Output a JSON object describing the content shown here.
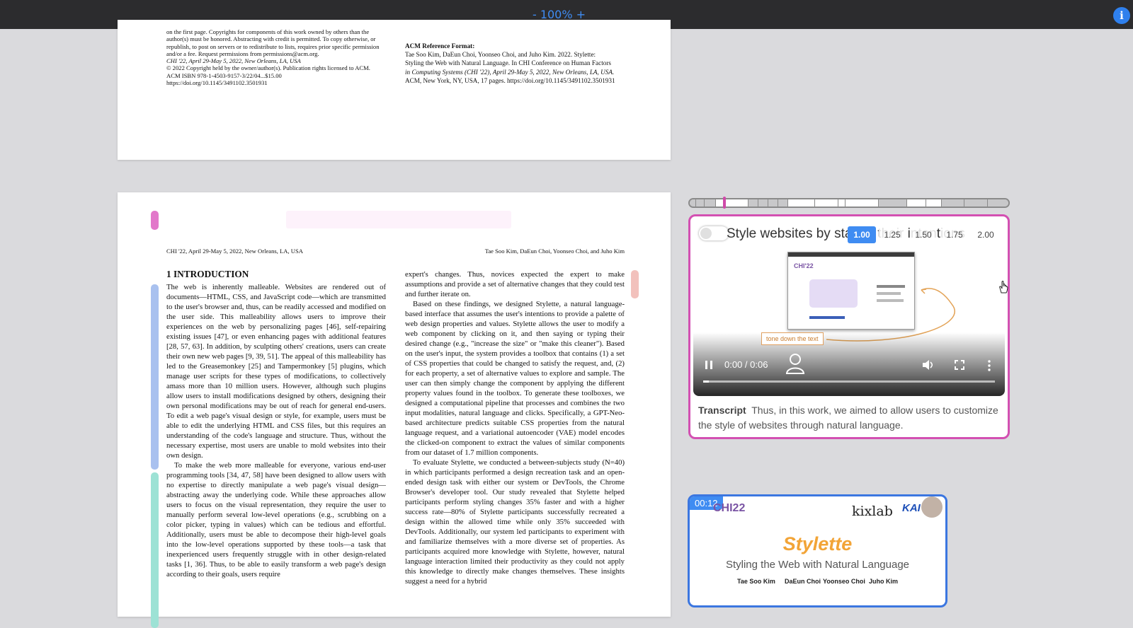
{
  "toolbar": {
    "zoom_out": "-",
    "zoom_level": "100%",
    "zoom_in": "+",
    "info_label": "i"
  },
  "page1": {
    "left_lines": [
      "on the first page. Copyrights for components of this work owned by others than the",
      "author(s) must be honored. Abstracting with credit is permitted. To copy otherwise, or",
      "republish, to post on servers or to redistribute to lists, requires prior specific permission",
      "and/or a fee. Request permissions from permissions@acm.org.",
      "CHI '22, April 29-May 5, 2022, New Orleans, LA, USA",
      "© 2022 Copyright held by the owner/author(s). Publication rights licensed to ACM.",
      "ACM ISBN 978-1-4503-9157-3/22/04...$15.00",
      "https://doi.org/10.1145/3491102.3501931"
    ],
    "ref_heading": "ACM Reference Format:",
    "ref_lines": [
      "Tae Soo Kim, DaEun Choi, Yoonseo Choi, and Juho Kim. 2022. Stylette:",
      "Styling the Web with Natural Language. In CHI Conference on Human Factors",
      "in Computing Systems (CHI '22), April 29-May 5, 2022, New Orleans, LA, USA.",
      "ACM, New York, NY, USA, 17 pages. https://doi.org/10.1145/3491102.3501931"
    ]
  },
  "page2": {
    "header_left": "CHI '22, April 29-May 5, 2022, New Orleans, LA, USA",
    "header_right": "Tae Soo Kim, DaEun Choi, Yoonseo Choi, and Juho Kim",
    "section_title": "1   INTRODUCTION",
    "left_p1": "The web is inherently malleable. Websites are rendered out of documents—HTML, CSS, and JavaScript code—which are transmitted to the user's browser and, thus, can be readily accessed and modified on the user side. This malleability allows users to improve their experiences on the web by personalizing pages [46], self-repairing existing issues [47], or even enhancing pages with additional features [28, 57, 63]. In addition, by sculpting others' creations, users can create their own new web pages [9, 39, 51]. The appeal of this malleability has led to the Greasemonkey [25] and Tampermonkey [5] plugins, which manage user scripts for these types of modifications, to collectively amass more than 10 million users. However, although such plugins allow users to install modifications designed by others, designing their own personal modifications may be out of reach for general end-users. To edit a web page's visual design or style, for example, users must be able to edit the underlying HTML and CSS files, but this requires an understanding of the code's language and structure. Thus, without the necessary expertise, most users are unable to mold websites into their own design.",
    "left_p2": "To make the web more malleable for everyone, various end-user programming tools [34, 47, 58] have been designed to allow users with no expertise to directly manipulate a web page's visual design—abstracting away the underlying code. While these approaches allow users to focus on the visual representation, they require the user to manually perform several low-level operations (e.g., scrubbing on a color picker, typing in values) which can be tedious and effortful. Additionally, users must be able to decompose their high-level goals into the low-level operations supported by these tools—a task that inexperienced users frequently struggle with in other design-related tasks [1, 36]. Thus, to be able to easily transform a web page's design according to their goals, users require",
    "right_p1": "expert's changes. Thus, novices expected the expert to make assumptions and provide a set of alternative changes that they could test and further iterate on.",
    "right_p2": "Based on these findings, we designed Stylette, a natural language-based interface that assumes the user's intentions to provide a palette of web design properties and values. Stylette allows the user to modify a web component by clicking on it, and then saying or typing their desired change (e.g., \"increase the size\" or \"make this cleaner\"). Based on the user's input, the system provides a toolbox that contains (1) a set of CSS properties that could be changed to satisfy the request, and, (2) for each property, a set of alternative values to explore and sample. The user can then simply change the component by applying the different property values found in the toolbox. To generate these toolboxes, we designed a computational pipeline that processes and combines the two input modalities, natural language and clicks. Specifically, a GPT-Neo-based architecture predicts suitable CSS properties from the natural language request, and a variational autoencoder (VAE) model encodes the clicked-on component to extract the values of similar components from our dataset of 1.7 million components.",
    "right_p3": "To evaluate Stylette, we conducted a between-subjects study (N=40) in which participants performed a design recreation task and an open-ended design task with either our system or DevTools, the Chrome Browser's developer tool. Our study revealed that Stylette helped participants perform styling changes 35% faster and with a higher success rate—80% of Stylette participants successfully recreated a design within the allowed time while only 35% succeeded with DevTools. Additionally, our system led participants to experiment with and familiarize themselves with a more diverse set of properties. As participants acquired more knowledge with Stylette, however, natural language interaction limited their productivity as they could not apply this knowledge to directly make changes themselves. These insights suggest a need for a hybrid"
  },
  "video_card": {
    "title": "Style websites by stating their intentions",
    "speeds": [
      "1.00",
      "1.25",
      "1.50",
      "1.75",
      "2.00"
    ],
    "active_speed": "1.00",
    "prompt_text": "tone down the text",
    "shot_logo": "CHI'22",
    "time_display": "0:00 / 0:06",
    "progress": 0.02,
    "transcript_label": "Transcript",
    "transcript_text": "Thus, in this work, we aimed to allow users to customize the style of websites through natural language."
  },
  "slide_card": {
    "timestamp": "00:12",
    "chi_logo": "CHI22",
    "kixlab_logo": "kixlab",
    "kaist_logo": "KAI",
    "title": "Stylette",
    "subtitle": "Styling the Web with Natural Language",
    "authors": [
      "Tae Soo Kim",
      "DaEun Choi",
      "Yoonseo Choi",
      "Juho Kim"
    ]
  },
  "colors": {
    "accent": "#3f8cf2",
    "card_border_active": "#d350b2",
    "card_border_slide": "#3b76e0",
    "highlight_blue": "#a9c1ef",
    "highlight_teal": "#9de2d5",
    "highlight_pink": "#e78ad0",
    "highlight_salmon": "#f2c1bc",
    "topbar": "#2c2c2e"
  },
  "icons": [
    "info-icon",
    "pause-icon",
    "volume-icon",
    "fullscreen-icon",
    "more-vertical-icon",
    "hand-cursor-icon",
    "person-icon"
  ]
}
